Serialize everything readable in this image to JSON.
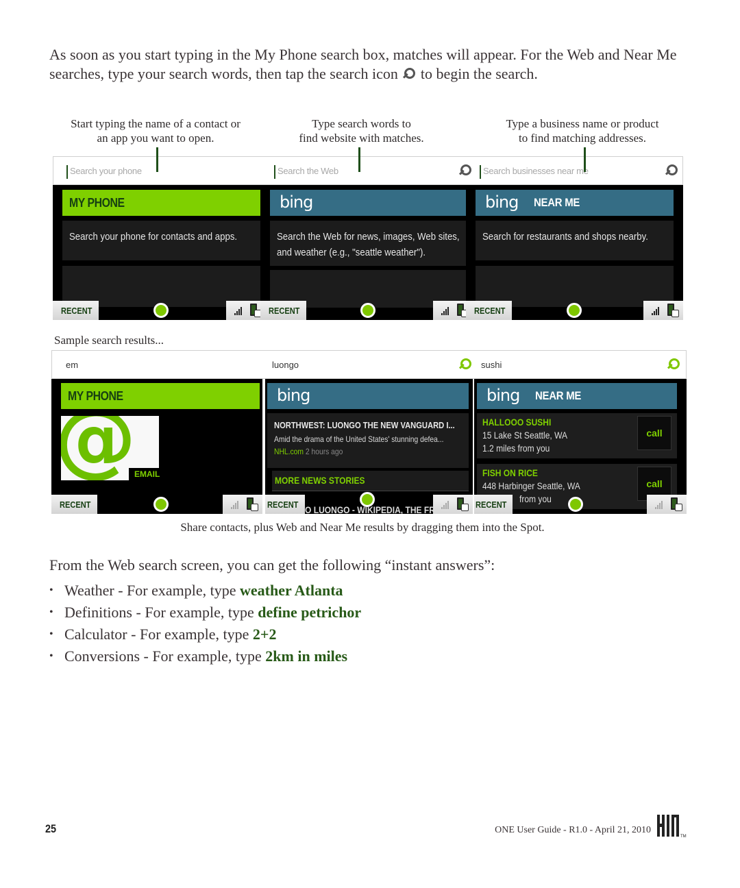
{
  "intro": {
    "line_before_icon": "As soon as you start typing in the My Phone search box, matches will appear. For the Web and Near Me searches, type your search words, then tap the search icon",
    "line_after_icon": "to begin the search.",
    "icon": "search-icon"
  },
  "callouts": [
    {
      "line1": "Start typing the name of a contact or",
      "line2": "an app you want to open."
    },
    {
      "line1": "Type search words to",
      "line2": "find website with matches."
    },
    {
      "line1": "Type a business name or product",
      "line2": "to find matching addresses."
    }
  ],
  "top_screens": {
    "search_fields": [
      {
        "placeholder": "Search your phone",
        "has_search_icon": false
      },
      {
        "placeholder": "Search the Web",
        "has_search_icon": true
      },
      {
        "placeholder": "Search businesses near me",
        "has_search_icon": true
      }
    ],
    "panels": [
      {
        "header": "MY PHONE",
        "header_style": "green",
        "description": "Search your phone for contacts and apps."
      },
      {
        "header": "bing",
        "header_style": "blue",
        "description_line1": "Search the Web for news, images, Web sites,",
        "description_line2": "and weather (e.g., \"seattle weather\")."
      },
      {
        "header": "bing",
        "header_suffix": "NEAR ME",
        "header_style": "blue",
        "description": "Search for restaurants and shops nearby."
      }
    ]
  },
  "sample_label": "Sample search results...",
  "sample_screens": {
    "search_values": [
      "em",
      "luongo",
      "sushi"
    ],
    "my_phone": {
      "header": "MY PHONE",
      "result_label": "EMAIL",
      "result_glyph": "@"
    },
    "web": {
      "header": "bing",
      "headline": "NORTHWEST: LUONGO THE NEW VANGUARD I...",
      "snippet": "Amid the drama of the United States' stunning defea...",
      "source": "NHL.com",
      "age": "2 hours ago",
      "more_label": "MORE NEWS STORIES",
      "behind_text": "O LUONGO - WIKIPEDIA, THE FRE"
    },
    "near_me": {
      "header": "bing",
      "header_suffix": "NEAR ME",
      "results": [
        {
          "name": "HALLOOO SUSHI",
          "address": "15 Lake St  Seattle, WA",
          "distance": "1.2 miles from you",
          "action": "call"
        },
        {
          "name": "FISH ON RICE",
          "address": "448 Harbinger Seattle, WA",
          "distance": "from you",
          "action": "call"
        }
      ]
    }
  },
  "bottom_bar": {
    "recent_label": "RECENT"
  },
  "caption": "Share contacts, plus Web and Near Me results by dragging them into the Spot.",
  "answers": {
    "intro": "From the Web search screen, you can get the following “instant answers”:",
    "bullet": "•",
    "items": [
      {
        "label": "Weather - For example, type ",
        "example": "weather Atlanta"
      },
      {
        "label": "Definitions - For example, type ",
        "example": "define petrichor"
      },
      {
        "label": "Calculator - For example, type ",
        "example": "2+2"
      },
      {
        "label": "Conversions - For example, type ",
        "example": "2km in miles"
      }
    ]
  },
  "footer": {
    "page_number": "25",
    "guide_text": "ONE User Guide - R1.0 - April 21, 2010",
    "logo_text": "KIN",
    "trademark": "TM"
  },
  "colors": {
    "kin_green": "#7fd000",
    "bing_blue": "#356d85",
    "example_green": "#285a18",
    "pointer_green": "#1f4f1a"
  }
}
